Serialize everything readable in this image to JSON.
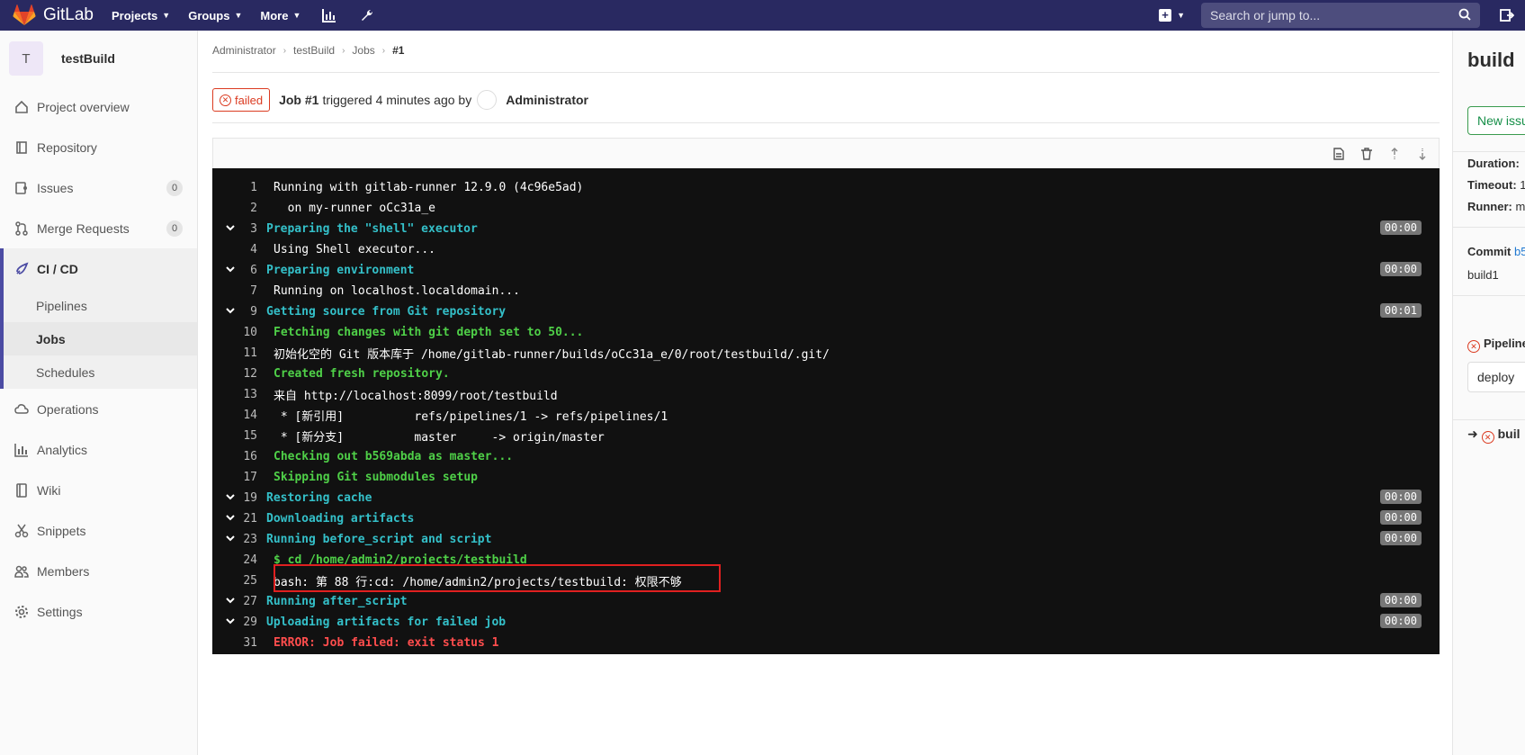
{
  "topbar": {
    "brand": "GitLab",
    "nav": [
      {
        "label": "Projects"
      },
      {
        "label": "Groups"
      },
      {
        "label": "More"
      }
    ],
    "search_placeholder": "Search or jump to..."
  },
  "sidebar": {
    "project_initial": "T",
    "project_name": "testBuild",
    "items": {
      "overview": "Project overview",
      "repository": "Repository",
      "issues": "Issues",
      "issues_count": "0",
      "merge_requests": "Merge Requests",
      "mr_count": "0",
      "cicd": "CI / CD",
      "pipelines": "Pipelines",
      "jobs": "Jobs",
      "schedules": "Schedules",
      "operations": "Operations",
      "analytics": "Analytics",
      "wiki": "Wiki",
      "snippets": "Snippets",
      "members": "Members",
      "settings": "Settings"
    }
  },
  "breadcrumb": [
    "Administrator",
    "testBuild",
    "Jobs",
    "#1"
  ],
  "job": {
    "status": "failed",
    "title": "Job #1",
    "triggered": "triggered 4 minutes ago by",
    "user": "Administrator"
  },
  "log": [
    {
      "n": "1",
      "text": "Running with gitlab-runner 12.9.0 (4c96e5ad)",
      "cls": ""
    },
    {
      "n": "2",
      "text": "  on my-runner oCc31a_e",
      "cls": ""
    },
    {
      "n": "3",
      "text": "Preparing the \"shell\" executor",
      "cls": "c-cyan",
      "section": true,
      "dur": "00:00"
    },
    {
      "n": "4",
      "text": "Using Shell executor...",
      "cls": ""
    },
    {
      "n": "6",
      "text": "Preparing environment",
      "cls": "c-cyan",
      "section": true,
      "dur": "00:00"
    },
    {
      "n": "7",
      "text": "Running on localhost.localdomain...",
      "cls": ""
    },
    {
      "n": "9",
      "text": "Getting source from Git repository",
      "cls": "c-cyan",
      "section": true,
      "dur": "00:01"
    },
    {
      "n": "10",
      "text": "Fetching changes with git depth set to 50...",
      "cls": "c-green"
    },
    {
      "n": "11",
      "text": "初始化空的 Git 版本库于 /home/gitlab-runner/builds/oCc31a_e/0/root/testbuild/.git/",
      "cls": ""
    },
    {
      "n": "12",
      "text": "Created fresh repository.",
      "cls": "c-green"
    },
    {
      "n": "13",
      "text": "来自 http://localhost:8099/root/testbuild",
      "cls": ""
    },
    {
      "n": "14",
      "text": " * [新引用]          refs/pipelines/1 -> refs/pipelines/1",
      "cls": ""
    },
    {
      "n": "15",
      "text": " * [新分支]          master     -> origin/master",
      "cls": ""
    },
    {
      "n": "16",
      "text": "Checking out b569abda as master...",
      "cls": "c-green"
    },
    {
      "n": "17",
      "text": "Skipping Git submodules setup",
      "cls": "c-green"
    },
    {
      "n": "19",
      "text": "Restoring cache",
      "cls": "c-cyan",
      "section": true,
      "dur": "00:00"
    },
    {
      "n": "21",
      "text": "Downloading artifacts",
      "cls": "c-cyan",
      "section": true,
      "dur": "00:00"
    },
    {
      "n": "23",
      "text": "Running before_script and script",
      "cls": "c-cyan",
      "section": true,
      "dur": "00:00"
    },
    {
      "n": "24",
      "text": "$ cd /home/admin2/projects/testbuild",
      "cls": "c-green"
    },
    {
      "n": "25",
      "text": "bash: 第 88 行:cd: /home/admin2/projects/testbuild: 权限不够",
      "cls": ""
    },
    {
      "n": "27",
      "text": "Running after_script",
      "cls": "c-cyan",
      "section": true,
      "dur": "00:00"
    },
    {
      "n": "29",
      "text": "Uploading artifacts for failed job",
      "cls": "c-cyan",
      "section": true,
      "dur": "00:00"
    },
    {
      "n": "31",
      "text": "ERROR: Job failed: exit status 1",
      "cls": "c-red"
    }
  ],
  "right_sidebar": {
    "title": "build",
    "new_issue": "New issue",
    "duration_label": "Duration:",
    "timeout_label": "Timeout:",
    "timeout_value": "1",
    "runner_label": "Runner:",
    "runner_value": "m",
    "commit_label": "Commit",
    "commit_value": "b5",
    "commit_msg": "build1",
    "pipeline_label": "Pipeline",
    "stage": "deploy",
    "job_link": "buil"
  }
}
